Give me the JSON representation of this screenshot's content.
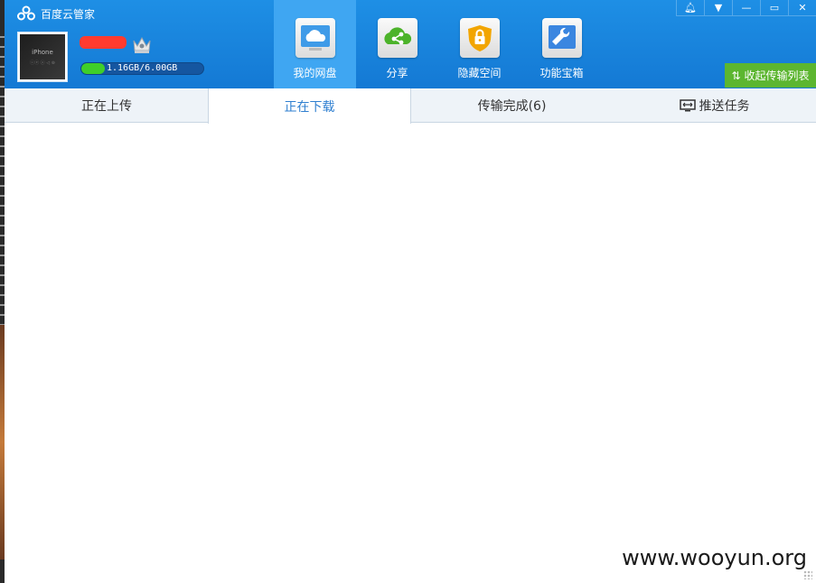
{
  "window": {
    "title": "百度云管家"
  },
  "account": {
    "avatar_label": "iPhone",
    "avatar_sublabel": "ⓒⓔ ⓧ ◁ ⊚",
    "quota_used_fraction": 0.19,
    "quota_text": "1.16GB/6.00GB"
  },
  "nav": [
    {
      "label": "我的网盘",
      "icon": "cloud-icon",
      "active": true
    },
    {
      "label": "分享",
      "icon": "share-icon",
      "active": false
    },
    {
      "label": "隐藏空间",
      "icon": "lock-shield-icon",
      "active": false
    },
    {
      "label": "功能宝箱",
      "icon": "wrench-icon",
      "active": false
    }
  ],
  "window_controls": [
    "bell-icon",
    "dropdown-icon",
    "minimize-icon",
    "maximize-icon",
    "close-icon"
  ],
  "collapse_button": {
    "label": "收起传输列表"
  },
  "tabs": [
    {
      "label": "正在上传",
      "active": false
    },
    {
      "label": "正在下载",
      "active": true
    },
    {
      "label": "传输完成(6)",
      "active": false
    },
    {
      "label": "推送任务",
      "active": false
    }
  ],
  "watermark": "www.wooyun.org",
  "colors": {
    "header": "#1479d4",
    "accent": "#2f7fd0",
    "collapse": "#5cb630"
  }
}
